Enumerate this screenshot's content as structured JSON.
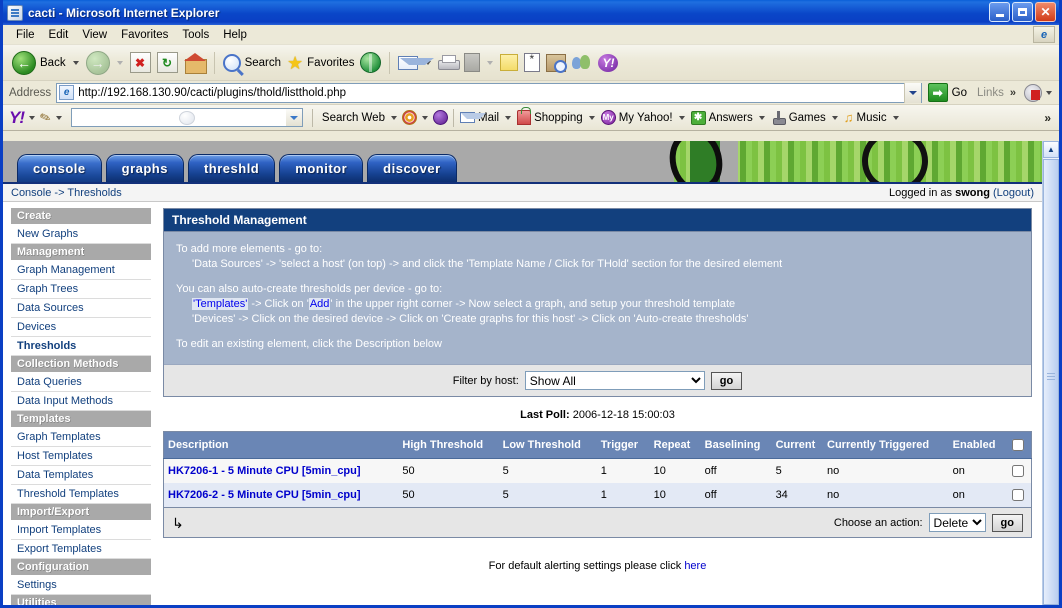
{
  "window": {
    "title": "cacti - Microsoft Internet Explorer",
    "minimize_label": "–",
    "maximize_label": "",
    "close_label": "✕"
  },
  "menubar": {
    "items": [
      "File",
      "Edit",
      "View",
      "Favorites",
      "Tools",
      "Help"
    ]
  },
  "toolbar": {
    "back_label": "Back",
    "forward_label": "",
    "stop_label": "✖",
    "refresh_label": "↻",
    "home_label": "",
    "search_label": "Search",
    "favorites_label": "Favorites",
    "media_label": "",
    "history_label": "",
    "mail_label": "",
    "print_label": "",
    "edit_label": "",
    "discuss_label": "",
    "messenger_label": ""
  },
  "address": {
    "label": "Address",
    "url": "http://192.168.130.90/cacti/plugins/thold/listthold.php",
    "favicon_letter": "e",
    "go_label": "Go",
    "go_icon": "➡",
    "links_label": "Links",
    "chevron": "»"
  },
  "yahoo_toolbar": {
    "logo": "Y!",
    "search_value": "",
    "search_web_label": "Search Web",
    "items": [
      {
        "label": "Mail",
        "icon": "mail-icon"
      },
      {
        "label": "Shopping",
        "icon": "shopping-icon"
      },
      {
        "label": "My Yahoo!",
        "icon": "my-yahoo-icon"
      },
      {
        "label": "Answers",
        "icon": "answers-icon"
      },
      {
        "label": "Games",
        "icon": "games-icon"
      },
      {
        "label": "Music",
        "icon": "music-icon"
      }
    ],
    "overflow": "»"
  },
  "cacti": {
    "tabs": [
      {
        "label": "console",
        "selected": true
      },
      {
        "label": "graphs",
        "selected": false
      },
      {
        "label": "threshld",
        "selected": false
      },
      {
        "label": "monitor",
        "selected": false
      },
      {
        "label": "discover",
        "selected": false
      }
    ],
    "breadcrumb": "Console -> Thresholds",
    "login_prefix": "Logged in as",
    "login_user": "swong",
    "logout_label": "(Logout)"
  },
  "sidebar": {
    "groups": [
      {
        "header": "Create",
        "items": [
          {
            "label": "New Graphs",
            "current": false
          }
        ]
      },
      {
        "header": "Management",
        "items": [
          {
            "label": "Graph Management",
            "current": false
          },
          {
            "label": "Graph Trees",
            "current": false
          },
          {
            "label": "Data Sources",
            "current": false
          },
          {
            "label": "Devices",
            "current": false
          },
          {
            "label": "Thresholds",
            "current": true
          }
        ]
      },
      {
        "header": "Collection Methods",
        "items": [
          {
            "label": "Data Queries",
            "current": false
          },
          {
            "label": "Data Input Methods",
            "current": false
          }
        ]
      },
      {
        "header": "Templates",
        "items": [
          {
            "label": "Graph Templates",
            "current": false
          },
          {
            "label": "Host Templates",
            "current": false
          },
          {
            "label": "Data Templates",
            "current": false
          },
          {
            "label": "Threshold Templates",
            "current": false
          }
        ]
      },
      {
        "header": "Import/Export",
        "items": [
          {
            "label": "Import Templates",
            "current": false
          },
          {
            "label": "Export Templates",
            "current": false
          }
        ]
      },
      {
        "header": "Configuration",
        "items": [
          {
            "label": "Settings",
            "current": false
          }
        ]
      },
      {
        "header": "Utilities",
        "items": []
      }
    ]
  },
  "panel": {
    "title": "Threshold Management",
    "para1_line1": "To add more elements - go to:",
    "para1_line2": "'Data Sources' -> 'select a host' (on top) -> and click the 'Template Name / Click for THold' section for the desired element",
    "para2_line1": "You can also auto-create thresholds per device - go to:",
    "para2_line2_link": "'Templates'",
    "para2_line2_mid": " -> Click on '",
    "para2_line2_link2": "Add",
    "para2_line2_end": "' in the upper right corner -> Now select a graph, and setup your threshold template",
    "para2_line3": "'Devices' -> Click on the desired device -> Click on 'Create graphs for this host' -> Click on 'Auto-create thresholds'",
    "para3": "To edit an existing element, click the Description below"
  },
  "filter": {
    "label": "Filter by host:",
    "selected": "Show All",
    "options": [
      "Show All"
    ],
    "go_label": "go"
  },
  "last_poll": {
    "label": "Last Poll:",
    "value": "2006-12-18 15:00:03"
  },
  "table": {
    "headers": [
      "Description",
      "High Threshold",
      "Low Threshold",
      "Trigger",
      "Repeat",
      "Baselining",
      "Current",
      "Currently Triggered",
      "Enabled"
    ],
    "rows": [
      {
        "description": "HK7206-1 - 5 Minute CPU [5min_cpu]",
        "high_threshold": "50",
        "low_threshold": "5",
        "trigger": "1",
        "repeat": "10",
        "baselining": "off",
        "current": "5",
        "currently_triggered": "no",
        "enabled": "on",
        "checked": false
      },
      {
        "description": "HK7206-2 - 5 Minute CPU [5min_cpu]",
        "high_threshold": "50",
        "low_threshold": "5",
        "trigger": "1",
        "repeat": "10",
        "baselining": "off",
        "current": "34",
        "currently_triggered": "no",
        "enabled": "on",
        "checked": false
      }
    ]
  },
  "actions": {
    "arrow_glyph": "↳",
    "label": "Choose an action:",
    "selected": "Delete",
    "options": [
      "Delete"
    ],
    "go_label": "go"
  },
  "footer": {
    "text": "For default alerting settings please click ",
    "link": "here"
  },
  "scrollbar": {
    "up_glyph": "▲",
    "down_glyph": "▼"
  },
  "colors": {
    "titlebar_blue": "#0a3fc4",
    "panel_header": "#12407e",
    "panel_body": "#a5b4cb",
    "table_header": "#6a86b5",
    "link": "#0000cc",
    "cacti_green": "#7dc242"
  }
}
